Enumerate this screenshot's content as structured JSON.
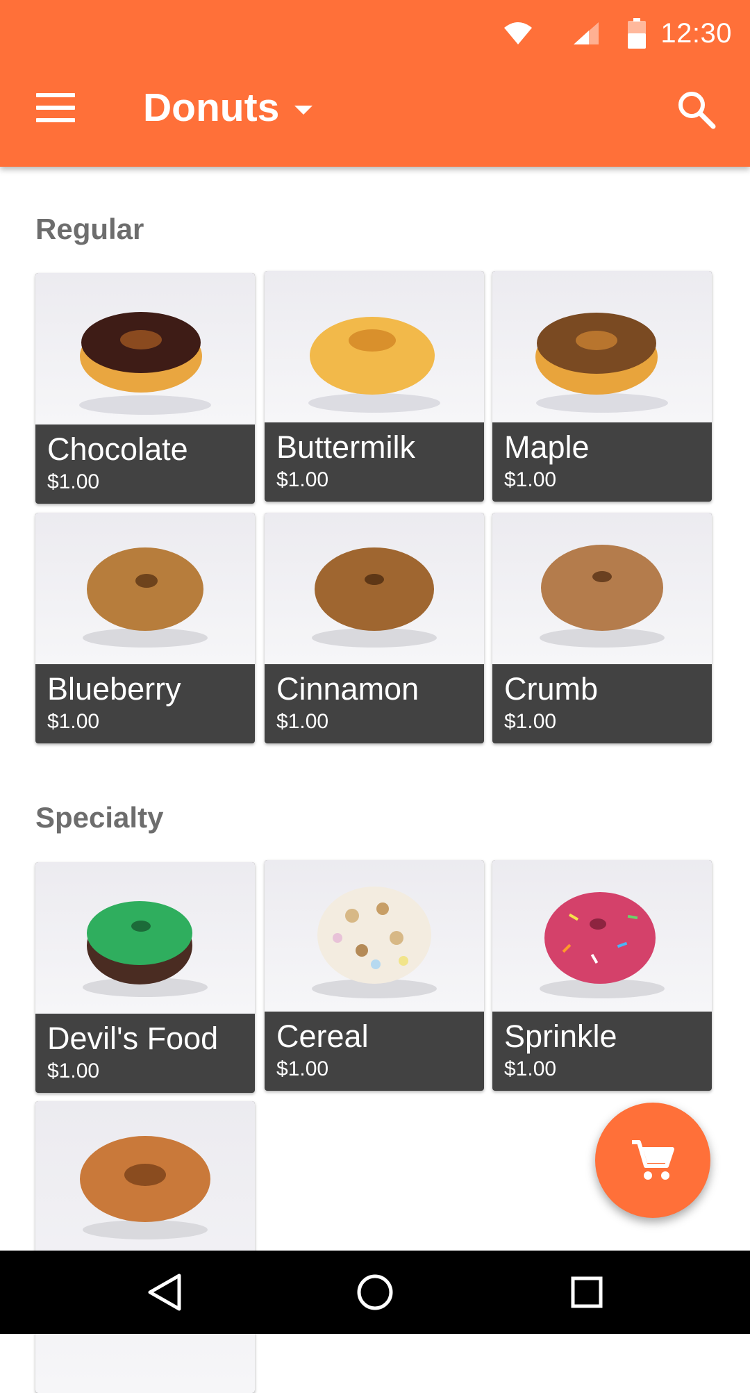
{
  "status_bar": {
    "time": "12:30",
    "icons": [
      "wifi-icon",
      "signal-icon",
      "battery-icon"
    ]
  },
  "toolbar": {
    "title": "Donuts",
    "menu_icon": "menu-icon",
    "dropdown_icon": "caret-down-icon",
    "search_icon": "search-icon",
    "background": "#ff7039"
  },
  "sections": [
    {
      "title": "Regular",
      "items": [
        {
          "name": "Chocolate",
          "price": "$1.00"
        },
        {
          "name": "Buttermilk",
          "price": "$1.00"
        },
        {
          "name": "Maple",
          "price": "$1.00"
        },
        {
          "name": "Blueberry",
          "price": "$1.00"
        },
        {
          "name": "Cinnamon",
          "price": "$1.00"
        },
        {
          "name": "Crumb",
          "price": "$1.00"
        }
      ]
    },
    {
      "title": "Specialty",
      "items": [
        {
          "name": "Devil's Food",
          "price": "$1.00"
        },
        {
          "name": "Cereal",
          "price": "$1.00"
        },
        {
          "name": "Sprinkle",
          "price": "$1.00"
        },
        {
          "name": "",
          "price": ""
        }
      ]
    }
  ],
  "fab": {
    "icon": "cart-icon",
    "color": "#ff7039"
  },
  "nav_bar": {
    "icons": [
      "back-icon",
      "home-icon",
      "recents-icon"
    ]
  },
  "colors": {
    "accent": "#ff7039",
    "card_caption": "#424242",
    "section_title": "#6d6d6d"
  }
}
